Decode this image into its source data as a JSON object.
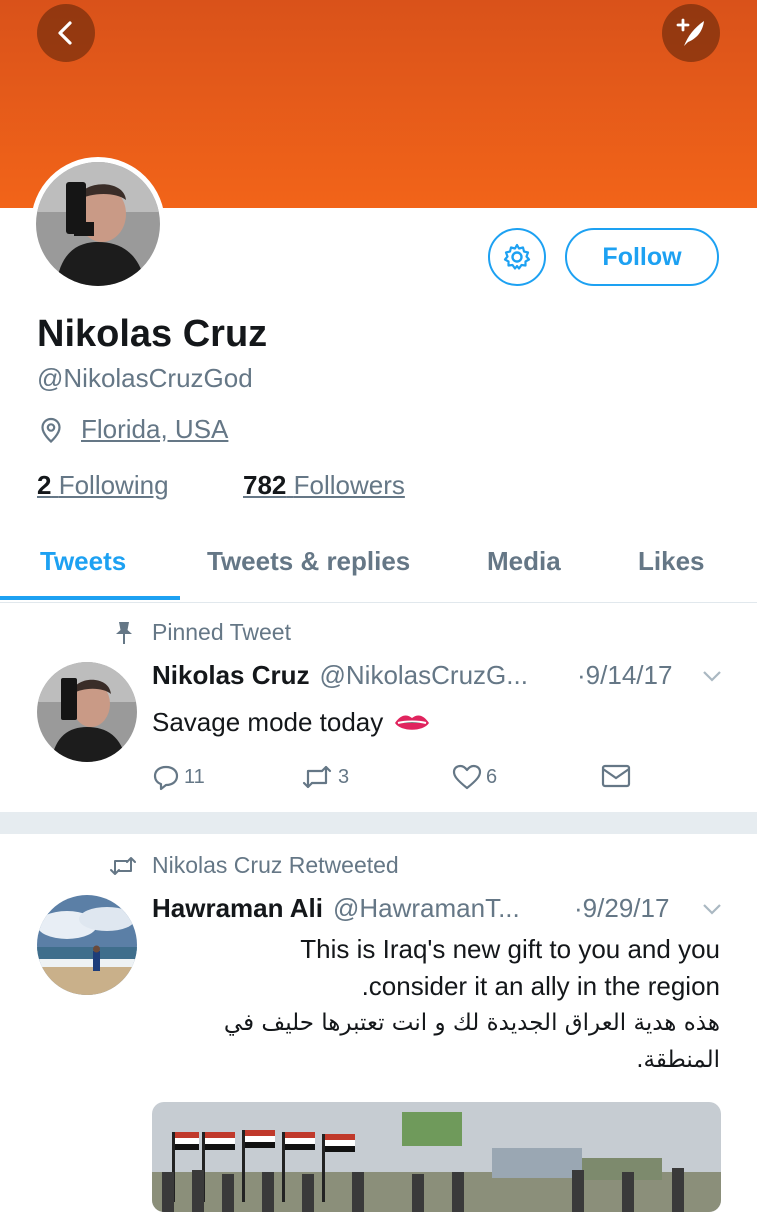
{
  "header": {
    "back_icon": "chevron-left-icon",
    "compose_icon": "compose-tweet-icon",
    "banner_color": "#f26419"
  },
  "profile": {
    "name": "Nikolas Cruz",
    "handle": "@NikolasCruzGod",
    "location": "Florida, USA",
    "following_count": "2",
    "following_label": "Following",
    "followers_count": "782",
    "followers_label": "Followers",
    "follow_label": "Follow"
  },
  "tabs": [
    {
      "label": "Tweets",
      "active": true
    },
    {
      "label": "Tweets & replies",
      "active": false
    },
    {
      "label": "Media",
      "active": false
    },
    {
      "label": "Likes",
      "active": false
    }
  ],
  "tweets": [
    {
      "context": "Pinned Tweet",
      "author_name": "Nikolas Cruz",
      "author_handle": "@NikolasCruzG...",
      "date": "9/14/17",
      "text": "Savage mode today",
      "emoji": "lips-icon",
      "replies": "11",
      "retweets": "3",
      "likes": "6"
    },
    {
      "context": "Nikolas Cruz Retweeted",
      "author_name": "Hawraman Ali",
      "author_handle": "@HawramanT...",
      "date": "9/29/17",
      "text_lines": [
        "This is Iraq's new gift to you and you",
        ".consider it an ally in the region",
        "هذه هدية العراق الجديدة لك و انت تعتبرها حليف في",
        "المنطقة."
      ]
    }
  ],
  "colors": {
    "accent": "#1da1f2",
    "muted": "#657786",
    "text": "#14171a"
  }
}
